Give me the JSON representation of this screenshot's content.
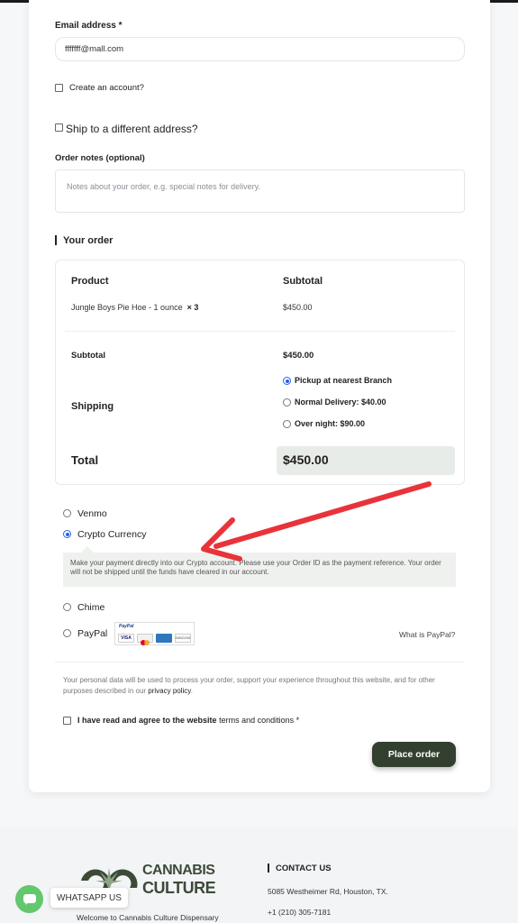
{
  "form": {
    "email_label": "Email address",
    "required_mark": "*",
    "email_value": "fffffff@mall.com",
    "create_account_label": "Create an account?",
    "ship_different_label": "Ship to a different address?",
    "order_notes_label": "Order notes (optional)",
    "order_notes_placeholder": "Notes about your order, e.g. special notes for delivery."
  },
  "order": {
    "title": "Your order",
    "col_product": "Product",
    "col_subtotal": "Subtotal",
    "item_name": "Jungle Boys Pie Hoe - 1 ounce",
    "item_qty": "× 3",
    "item_subtotal": "$450.00",
    "subtotal_label": "Subtotal",
    "subtotal_value": "$450.00",
    "shipping_label": "Shipping",
    "shipping_options": [
      {
        "label": "Pickup at nearest Branch",
        "selected": true
      },
      {
        "label": "Normal Delivery: $40.00",
        "selected": false
      },
      {
        "label": "Over night: $90.00",
        "selected": false
      }
    ],
    "total_label": "Total",
    "total_value": "$450.00"
  },
  "payment": {
    "methods": [
      {
        "label": "Venmo",
        "selected": false
      },
      {
        "label": "Crypto Currency",
        "selected": true
      },
      {
        "label": "Chime",
        "selected": false
      },
      {
        "label": "PayPal",
        "selected": false
      }
    ],
    "crypto_info": "Make your payment directly into our Crypto account. Please use your Order ID as the payment reference. Your order will not be shipped until the funds have cleared in our account.",
    "paypal_logo_text": "PayPal",
    "card_logos": [
      "VISA",
      "MC",
      "AMEX",
      "DISCOVER"
    ],
    "what_is_paypal": "What is PayPal?"
  },
  "privacy": {
    "text_before": "Your personal data will be used to process your order, support your experience throughout this website, and for other purposes described in our ",
    "link": "privacy policy",
    "text_after": "."
  },
  "terms": {
    "text": "I have read and agree to the website ",
    "link": "terms and conditions",
    "required_mark": "*"
  },
  "place_order_label": "Place order",
  "footer": {
    "brand_line1": "CANNABIS",
    "brand_line2": "CULTURE",
    "welcome": "Welcome to Cannabis Culture Dispensary",
    "contact_title": "CONTACT US",
    "address": "5085 Westheimer Rd, Houston, TX.",
    "phone": "+1 (210) 305-7181"
  },
  "whatsapp_label": "WHATSAPP US",
  "colors": {
    "accent": "#33402f",
    "radio_selected": "#2563eb",
    "annotation_arrow": "#e8333a",
    "whatsapp": "#63c76e"
  }
}
